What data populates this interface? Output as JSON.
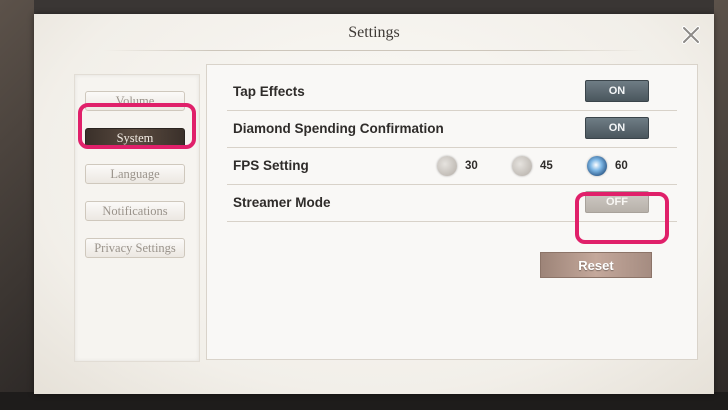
{
  "dialog": {
    "title": "Settings"
  },
  "sidebar": {
    "items": [
      {
        "label": "Volume",
        "active": false
      },
      {
        "label": "System",
        "active": true
      },
      {
        "label": "Language",
        "active": false
      },
      {
        "label": "Notifications",
        "active": false
      },
      {
        "label": "Privacy Settings",
        "active": false
      }
    ]
  },
  "settings": {
    "tap_effects": {
      "label": "Tap Effects",
      "value": "ON"
    },
    "diamond_spending": {
      "label": "Diamond Spending Confirmation",
      "value": "ON"
    },
    "fps": {
      "label": "FPS Setting",
      "options": [
        "30",
        "45",
        "60"
      ],
      "selected": "60"
    },
    "streamer_mode": {
      "label": "Streamer Mode",
      "value": "OFF"
    }
  },
  "actions": {
    "reset_label": "Reset"
  },
  "colors": {
    "highlight": "#e0206a",
    "toggle_on": "#4a565d",
    "toggle_off": "#b7b1aa",
    "reset_button": "#b39a8e",
    "selected_fps": "#2f5c8c"
  },
  "icons": {
    "close": "close-x-icon"
  }
}
